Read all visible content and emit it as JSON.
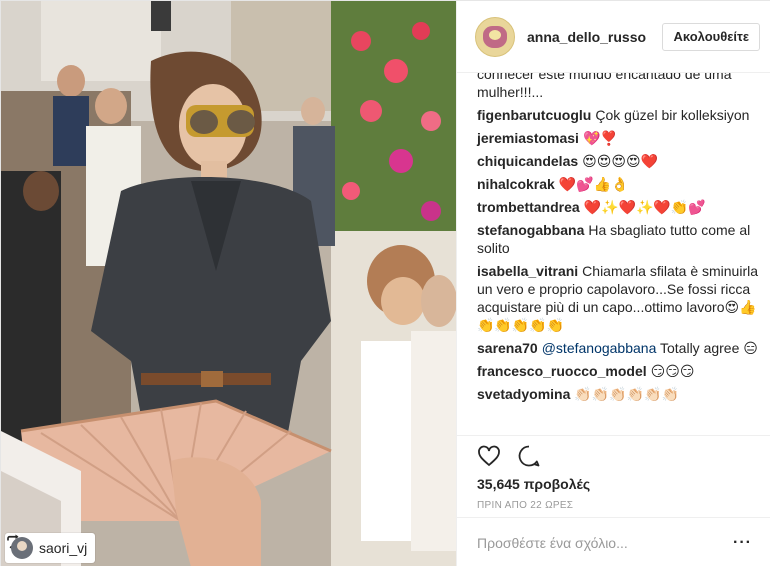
{
  "post": {
    "username": "anna_dello_russo",
    "follow_label": "Ακολουθείτε",
    "regram_user": "saori_vj",
    "caption_tail": "conhecer este mundo encantado de uma mulher!!!...",
    "comments": [
      {
        "user": "figenbarutcuoglu",
        "text": "Çok güzel bir kolleksiyon"
      },
      {
        "user": "jeremiastomasi",
        "text": "💖❣️"
      },
      {
        "user": "chiquicandelas",
        "text": "😍😍😍😍❤️"
      },
      {
        "user": "nihalcokrak",
        "text": "❤️💕👍👌"
      },
      {
        "user": "trombettandrea",
        "text": "❤️✨❤️✨❤️👏💕"
      },
      {
        "user": "stefanogabbana",
        "text": "Ha sbagliato tutto come al solito"
      },
      {
        "user": "isabella_vitrani",
        "text": "Chiamarla sfilata è sminuirla un vero e proprio capolavoro...Se fossi ricca acquistare più di un capo...ottimo lavoro😍👍👏👏👏👏👏"
      },
      {
        "user": "sarena70",
        "mention": "@stefanogabbana",
        "text": "Totally agree 😑"
      },
      {
        "user": "francesco_ruocco_model",
        "text": "😏😏😏"
      },
      {
        "user": "svetadyomina",
        "text": "👏🏻👏🏻👏🏻👏🏻👏🏻👏🏻"
      }
    ],
    "views": "35,645 προβολές",
    "time_ago": "ΠΡΙΝ ΑΠΟ 22 ΩΡΕΣ",
    "comment_placeholder": "Προσθέστε ένα σχόλιο...",
    "more_options": "···"
  },
  "icons": {
    "like": "heart-icon",
    "comment": "comment-bubble-icon",
    "regram": "regram-icon",
    "more": "more-options-icon"
  },
  "colors": {
    "text": "#262626",
    "muted": "#999999",
    "border": "#efefef",
    "mention": "#003569"
  }
}
